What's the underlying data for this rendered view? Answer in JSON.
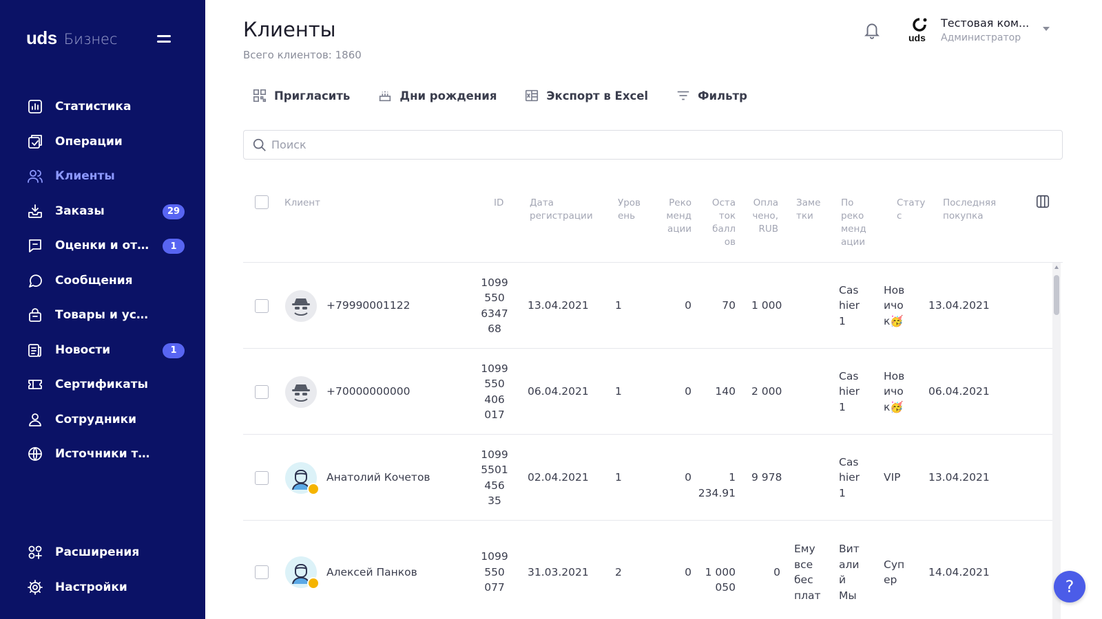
{
  "brand": {
    "logo": "uds",
    "product": "Бизнес"
  },
  "sidebar": {
    "items": [
      {
        "label": "Статистика",
        "icon": "chart-icon"
      },
      {
        "label": "Операции",
        "icon": "operations-icon"
      },
      {
        "label": "Клиенты",
        "icon": "users-icon",
        "active": true
      },
      {
        "label": "Заказы",
        "icon": "orders-icon",
        "badge": "29"
      },
      {
        "label": "Оценки и отзывы",
        "icon": "reviews-icon",
        "badge": "1"
      },
      {
        "label": "Сообщения",
        "icon": "chat-icon"
      },
      {
        "label": "Товары и услуги",
        "icon": "bag-icon"
      },
      {
        "label": "Новости",
        "icon": "news-icon",
        "badge": "1"
      },
      {
        "label": "Сертификаты",
        "icon": "ticket-icon"
      },
      {
        "label": "Сотрудники",
        "icon": "person-icon"
      },
      {
        "label": "Источники трафика",
        "icon": "globe-icon"
      }
    ],
    "bottom": [
      {
        "label": "Расширения",
        "icon": "extensions-icon"
      },
      {
        "label": "Настройки",
        "icon": "gear-icon"
      }
    ]
  },
  "header": {
    "title": "Клиенты",
    "subtitle": "Всего клиентов: 1860",
    "company_name": "Тестовая ком...",
    "company_role": "Администратор",
    "company_logo_text": "uds"
  },
  "toolbar": {
    "invite": "Пригласить",
    "birthdays": "Дни рождения",
    "export": "Экспорт в Excel",
    "filter": "Фильтр"
  },
  "search": {
    "placeholder": "Поиск"
  },
  "table": {
    "columns": {
      "client": "Клиент",
      "id": "ID",
      "reg_date": "Дата\nрегистрации",
      "level": "Уров\nень",
      "recs": "Реко\nменд\nации",
      "balance": "Оста\nток\nбалл\nов",
      "paid": "Опла\nчено,\nRUB",
      "notes": "Заме\nтки",
      "by_rec": "По\nреко\nменд\nации",
      "status": "Стату\nс",
      "last": "Последняя\nпокупка"
    },
    "rows": [
      {
        "name": "+79990001122",
        "avatar": "anon",
        "id": "1099\n550\n6347\n68",
        "reg": "13.04.2021",
        "level": "1",
        "recs": "0",
        "balance": "70",
        "paid": "1 000",
        "notes": "",
        "by_rec": "Cas\nhier\n1",
        "status": "Нов\nичо\nк🥳",
        "last": "13.04.2021"
      },
      {
        "name": "+70000000000",
        "avatar": "anon",
        "id": "1099\n550\n406\n017",
        "reg": "06.04.2021",
        "level": "1",
        "recs": "0",
        "balance": "140",
        "paid": "2 000",
        "notes": "",
        "by_rec": "Cas\nhier\n1",
        "status": "Нов\nичо\nк🥳",
        "last": "06.04.2021"
      },
      {
        "name": "Анатолий Кочетов",
        "avatar": "user",
        "id": "1099\n5501\n456\n35",
        "reg": "02.04.2021",
        "level": "1",
        "recs": "0",
        "balance": "1 234.91",
        "paid": "9 978",
        "notes": "",
        "by_rec": "Cas\nhier\n1",
        "status": "VIP",
        "last": "13.04.2021"
      },
      {
        "name": "Алексей Панков",
        "avatar": "user",
        "id": "1099\n550\n077",
        "reg": "31.03.2021",
        "level": "2",
        "recs": "0",
        "balance": "1 000 050",
        "paid": "0",
        "notes": "Ему\nвсе\nбес\nплат",
        "by_rec": "Вит\nали\nй\nМы",
        "status": "Суп\nер",
        "last": "14.04.2021"
      }
    ]
  },
  "help": {
    "label": "?"
  },
  "colors": {
    "sidebar_bg": "#0b1266",
    "accent": "#5865f2",
    "active_nav": "#8c98ff"
  }
}
